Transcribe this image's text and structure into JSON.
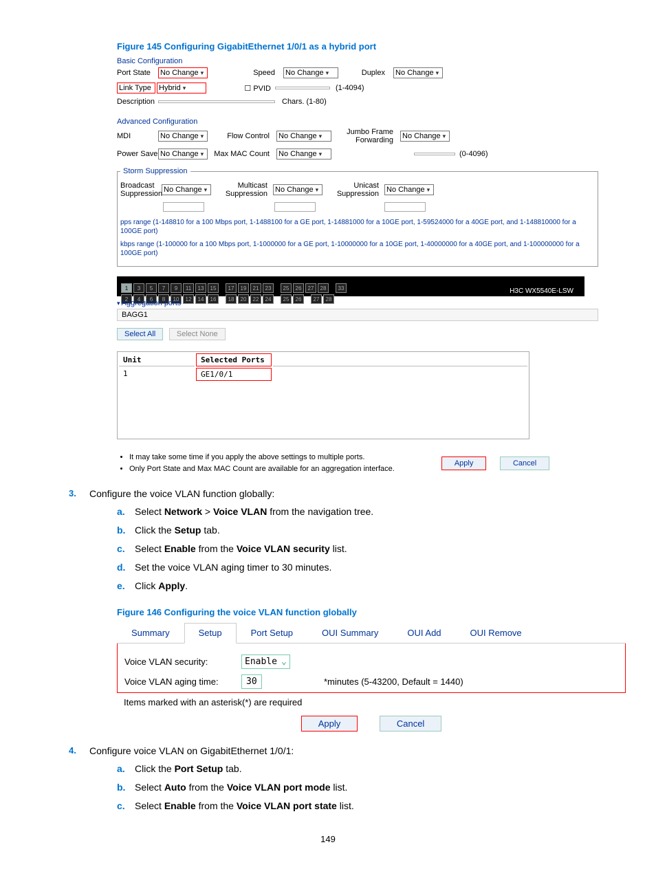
{
  "figure145_title": "Figure 145 Configuring GigabitEthernet 1/0/1 as a hybrid port",
  "fig145": {
    "basic_hdr": "Basic Configuration",
    "row1": {
      "port_state_lbl": "Port State",
      "port_state_val": "No Change",
      "speed_lbl": "Speed",
      "speed_val": "No Change",
      "duplex_lbl": "Duplex",
      "duplex_val": "No Change"
    },
    "row2": {
      "link_type_lbl": "Link Type",
      "link_type_val": "Hybrid",
      "pvid_lbl": "PVID",
      "pvid_val": "",
      "pvid_range": "(1-4094)"
    },
    "row3": {
      "desc_lbl": "Description",
      "desc_val": "",
      "desc_range": "Chars. (1-80)"
    },
    "adv_hdr": "Advanced Configuration",
    "row4": {
      "mdi_lbl": "MDI",
      "mdi_val": "No Change",
      "flow_lbl": "Flow Control",
      "flow_val": "No Change",
      "jumbo_lbl": "Jumbo Frame Forwarding",
      "jumbo_val": "No Change"
    },
    "row5": {
      "pwr_lbl": "Power Save",
      "pwr_val": "No Change",
      "mac_lbl": "Max MAC Count",
      "mac_val": "No Change",
      "mac_range": "(0-4096)"
    },
    "storm_hdr": "Storm Suppression",
    "row6": {
      "bcast_lbl": "Broadcast Suppression",
      "bcast_val": "No Change",
      "mcast_lbl": "Multicast Suppression",
      "mcast_val": "No Change",
      "ucast_lbl": "Unicast Suppression",
      "ucast_val": "No Change"
    },
    "range_note1": "pps range (1-148810 for a 100 Mbps port, 1-1488100 for a GE port, 1-14881000 for a 10GE port, 1-59524000 for a 40GE port, and 1-148810000 for a 100GE port)",
    "range_note2": "kbps range (1-100000 for a 100 Mbps port, 1-1000000 for a GE port, 1-10000000 for a 10GE port, 1-40000000 for a 40GE port, and 1-100000000 for a 100GE port)",
    "brand": "H3C WX5540E-LSW",
    "agg_hdr": "Aggregation ports",
    "agg_item": "BAGG1",
    "btn_select_all": "Select All",
    "btn_select_none": "Select None",
    "selected_table": {
      "col1": "Unit",
      "col2": "Selected Ports",
      "r1c1": "1",
      "r1c2": "GE1/0/1"
    },
    "note_bullet1": "It may take some time if you apply the above settings to multiple ports.",
    "note_bullet2": "Only Port State and Max MAC Count are available for an aggregation interface.",
    "btn_apply": "Apply",
    "btn_cancel": "Cancel"
  },
  "step3": {
    "num": "3.",
    "text": "Configure the voice VLAN function globally:"
  },
  "step3_items": {
    "a": {
      "l": "a.",
      "pre": "Select ",
      "b1": "Network",
      "mid": " > ",
      "b2": "Voice VLAN",
      "post": " from the navigation tree."
    },
    "b": {
      "l": "b.",
      "pre": "Click the ",
      "b1": "Setup",
      "post": " tab."
    },
    "c": {
      "l": "c.",
      "pre": "Select ",
      "b1": "Enable",
      "mid": " from the ",
      "b2": "Voice VLAN security",
      "post": " list."
    },
    "d": {
      "l": "d.",
      "t": "Set the voice VLAN aging timer to 30 minutes."
    },
    "e": {
      "l": "e.",
      "pre": "Click ",
      "b1": "Apply",
      "post": "."
    }
  },
  "figure146_title": "Figure 146 Configuring the voice VLAN function globally",
  "fig146": {
    "tabs": {
      "summary": "Summary",
      "setup": "Setup",
      "port_setup": "Port Setup",
      "oui_summary": "OUI Summary",
      "oui_add": "OUI Add",
      "oui_remove": "OUI Remove"
    },
    "sec_lbl": "Voice VLAN security:",
    "sec_val": "Enable",
    "aging_lbl": "Voice VLAN aging time:",
    "aging_val": "30",
    "aging_hint": "*minutes (5-43200, Default = 1440)",
    "req_note": "Items marked with an asterisk(*) are required",
    "btn_apply": "Apply",
    "btn_cancel": "Cancel"
  },
  "step4": {
    "num": "4.",
    "text": "Configure voice VLAN on GigabitEthernet 1/0/1:"
  },
  "step4_items": {
    "a": {
      "l": "a.",
      "pre": "Click the ",
      "b1": "Port Setup",
      "post": " tab."
    },
    "b": {
      "l": "b.",
      "pre": "Select ",
      "b1": "Auto",
      "mid": " from the ",
      "b2": "Voice VLAN port mode",
      "post": " list."
    },
    "c": {
      "l": "c.",
      "pre": "Select ",
      "b1": "Enable",
      "mid": " from the ",
      "b2": "Voice VLAN port state",
      "post": " list."
    }
  },
  "page_number": "149"
}
